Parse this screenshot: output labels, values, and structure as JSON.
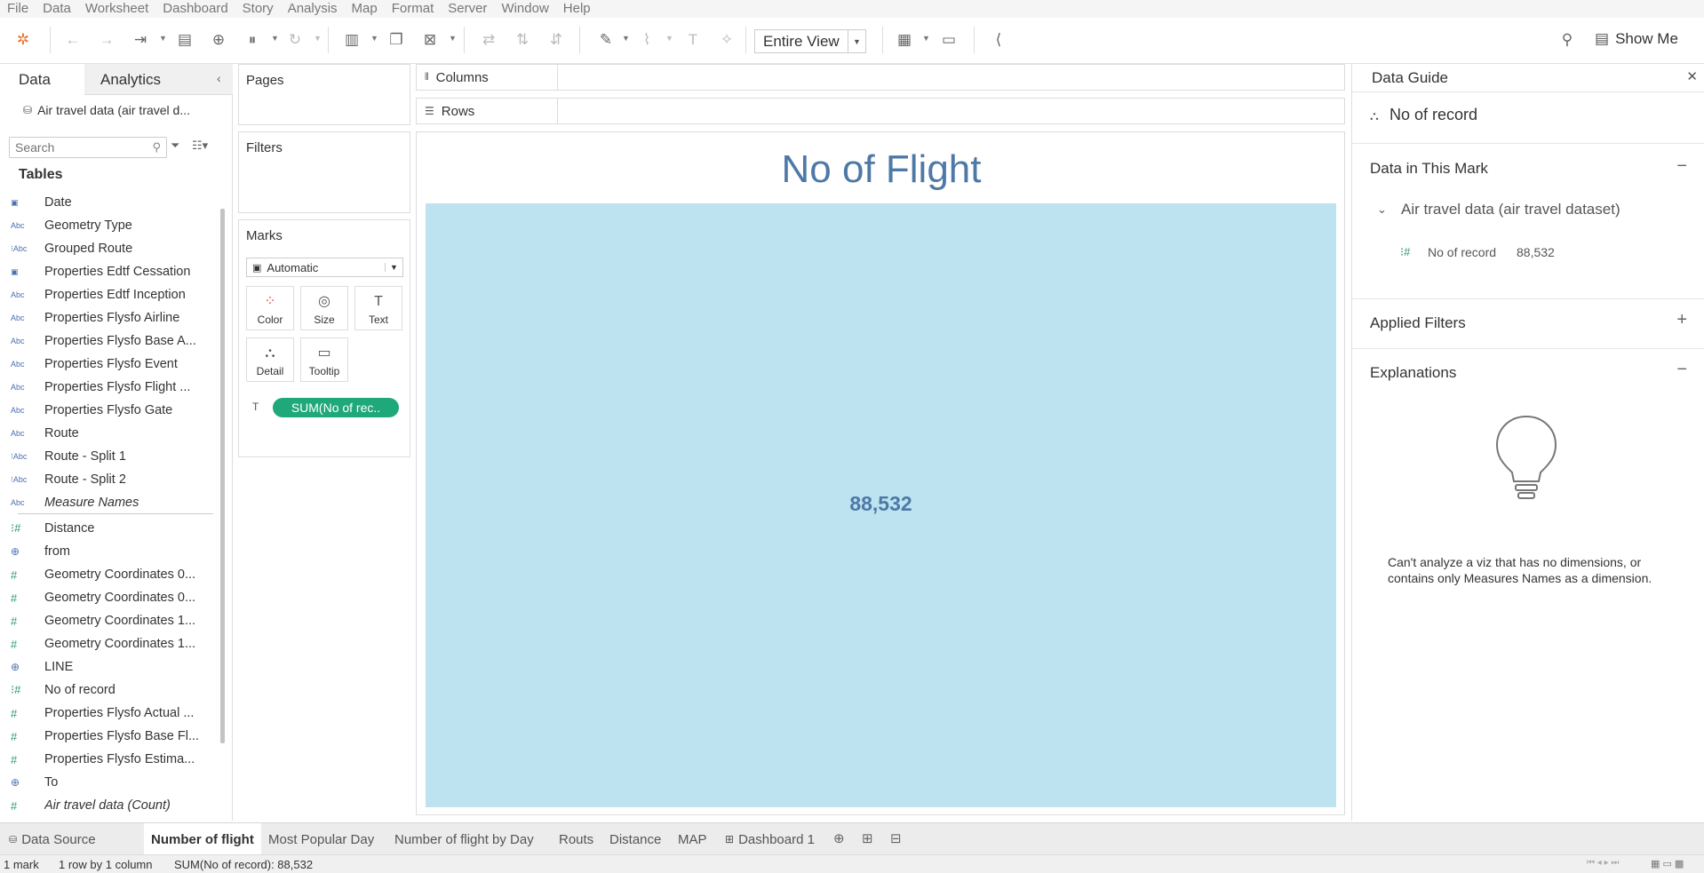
{
  "menu": [
    "File",
    "Data",
    "Worksheet",
    "Dashboard",
    "Story",
    "Analysis",
    "Map",
    "Format",
    "Server",
    "Window",
    "Help"
  ],
  "toolbar": {
    "view_select": "Entire View",
    "show_me": "Show Me"
  },
  "data_pane": {
    "tab_data": "Data",
    "tab_analytics": "Analytics",
    "datasource": "Air travel data (air travel d...",
    "search_placeholder": "Search",
    "tables_header": "Tables",
    "dimensions": [
      {
        "icon": "calendar-icon",
        "name": "Date"
      },
      {
        "icon": "abc-icon",
        "name": "Geometry Type"
      },
      {
        "icon": "group-abc-icon",
        "name": "Grouped Route"
      },
      {
        "icon": "calendar-icon",
        "name": "Properties Edtf Cessation"
      },
      {
        "icon": "abc-icon",
        "name": "Properties Edtf Inception"
      },
      {
        "icon": "abc-icon",
        "name": "Properties Flysfo Airline"
      },
      {
        "icon": "abc-icon",
        "name": "Properties Flysfo Base A..."
      },
      {
        "icon": "abc-icon",
        "name": "Properties Flysfo Event"
      },
      {
        "icon": "abc-icon",
        "name": "Properties Flysfo Flight ..."
      },
      {
        "icon": "abc-icon",
        "name": "Properties Flysfo Gate"
      },
      {
        "icon": "abc-icon",
        "name": "Route"
      },
      {
        "icon": "group-abc-icon",
        "name": "Route - Split 1"
      },
      {
        "icon": "group-abc-icon",
        "name": "Route - Split 2"
      },
      {
        "icon": "abc-icon",
        "name": "Measure Names",
        "italic": true
      }
    ],
    "measures": [
      {
        "icon": "bin-measure-icon",
        "name": "Distance"
      },
      {
        "icon": "globe-icon",
        "name": "from"
      },
      {
        "icon": "measure-icon",
        "name": "Geometry Coordinates 0..."
      },
      {
        "icon": "measure-icon",
        "name": "Geometry Coordinates 0..."
      },
      {
        "icon": "measure-icon",
        "name": "Geometry Coordinates 1..."
      },
      {
        "icon": "measure-icon",
        "name": "Geometry Coordinates 1..."
      },
      {
        "icon": "globe-icon",
        "name": "LINE"
      },
      {
        "icon": "bin-measure-icon",
        "name": "No of record"
      },
      {
        "icon": "measure-icon",
        "name": "Properties Flysfo Actual ..."
      },
      {
        "icon": "measure-icon",
        "name": "Properties Flysfo Base Fl..."
      },
      {
        "icon": "measure-icon",
        "name": "Properties Flysfo Estima..."
      },
      {
        "icon": "globe-icon",
        "name": "To"
      },
      {
        "icon": "measure-icon",
        "name": "Air travel data (Count)",
        "italic": true
      }
    ]
  },
  "shelves": {
    "pages": "Pages",
    "filters": "Filters",
    "marks": "Marks",
    "mark_type": "Automatic",
    "mark_buttons": [
      "Color",
      "Size",
      "Text",
      "Detail",
      "Tooltip"
    ],
    "pill": "SUM(No of rec..",
    "columns": "Columns",
    "rows": "Rows"
  },
  "viz": {
    "title": "No of Flight",
    "value": "88,532",
    "mark_color": "#bde3f0",
    "title_color": "#4e79a7"
  },
  "data_guide": {
    "title": "Data Guide",
    "selected_field": "No of record",
    "section_mark": "Data in This Mark",
    "datasource": "Air travel data (air travel dataset)",
    "mark_field": "No of record",
    "mark_value": "88,532",
    "section_filters": "Applied Filters",
    "section_explanations": "Explanations",
    "explain_text": "Can't analyze a viz that has no dimensions, or contains only Measures Names as a dimension."
  },
  "bottom_tabs": [
    "Data Source",
    "Number of flight",
    "Most Popular Day",
    "Number of flight by Day",
    "Routs",
    "Distance",
    "MAP",
    "Dashboard 1"
  ],
  "status": {
    "marks": "1 mark",
    "dims": "1 row by 1 column",
    "sum": "SUM(No of record): 88,532"
  }
}
